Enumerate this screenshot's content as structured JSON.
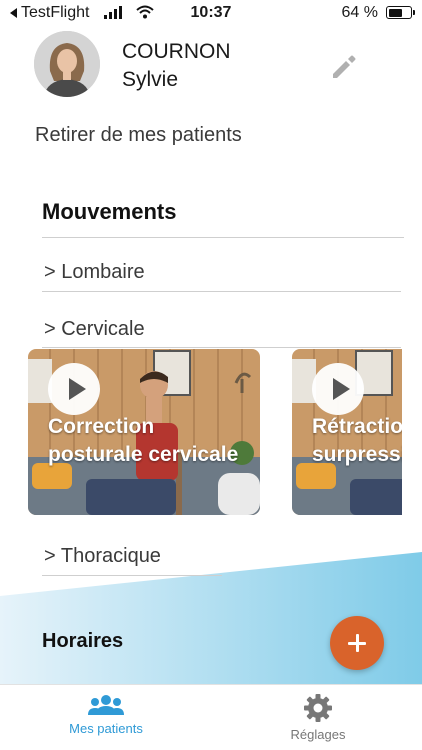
{
  "status_bar": {
    "back_app": "TestFlight",
    "time": "10:37",
    "battery_percent": "64 %",
    "battery_level": 0.64
  },
  "patient": {
    "last_name": "COURNON",
    "first_name": "Sylvie"
  },
  "actions": {
    "remove": "Retirer de mes patients"
  },
  "movements": {
    "title": "Mouvements",
    "categories": [
      {
        "label": "> Lombaire"
      },
      {
        "label": "> Cervicale"
      },
      {
        "label": "> Thoracique"
      }
    ],
    "videos": [
      {
        "title": "Correction posturale cervicale"
      },
      {
        "title": "Rétraction cervicale surpression"
      }
    ]
  },
  "schedule": {
    "title": "Horaires"
  },
  "tabs": [
    {
      "label": "Mes patients",
      "icon": "patients-icon",
      "active": true
    },
    {
      "label": "Réglages",
      "icon": "gear-icon",
      "active": false
    }
  ],
  "colors": {
    "accent": "#2f9ad6",
    "fab": "#d9632b",
    "wave_start": "#e6f3fa",
    "wave_end": "#7fcbe8"
  }
}
